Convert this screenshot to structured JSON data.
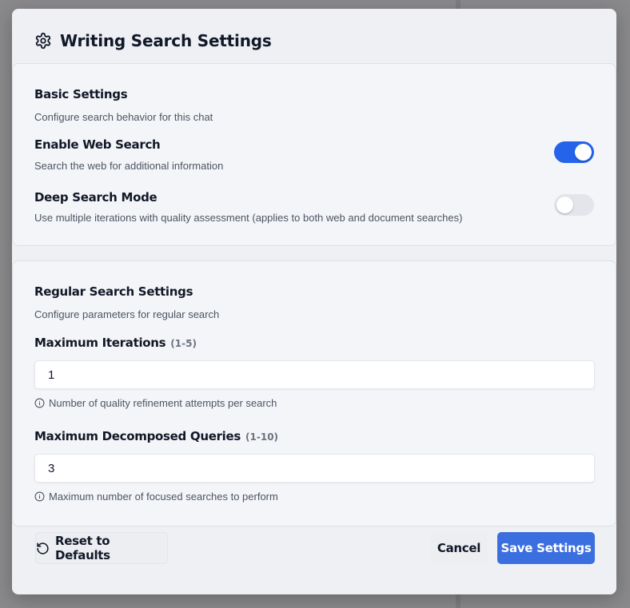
{
  "dialog": {
    "title": "Writing Search Settings",
    "title_icon": "gear-icon"
  },
  "basic": {
    "title": "Basic Settings",
    "description": "Configure search behavior for this chat",
    "web_search": {
      "label": "Enable Web Search",
      "description": "Search the web for additional information",
      "enabled": true
    },
    "deep_search": {
      "label": "Deep Search Mode",
      "description": "Use multiple iterations with quality assessment (applies to both web and document searches)",
      "enabled": false
    }
  },
  "regular": {
    "title": "Regular Search Settings",
    "description": "Configure parameters for regular search",
    "max_iterations": {
      "label": "Maximum Iterations",
      "range": "(1-5)",
      "value": "1",
      "hint": "Number of quality refinement attempts per search"
    },
    "max_queries": {
      "label": "Maximum Decomposed Queries",
      "range": "(1-10)",
      "value": "3",
      "hint": "Maximum number of focused searches to perform"
    }
  },
  "footer": {
    "reset_label": "Reset to Defaults",
    "cancel_label": "Cancel",
    "save_label": "Save Settings"
  },
  "colors": {
    "accent": "#2563eb",
    "save_button": "#3b6fe0"
  }
}
